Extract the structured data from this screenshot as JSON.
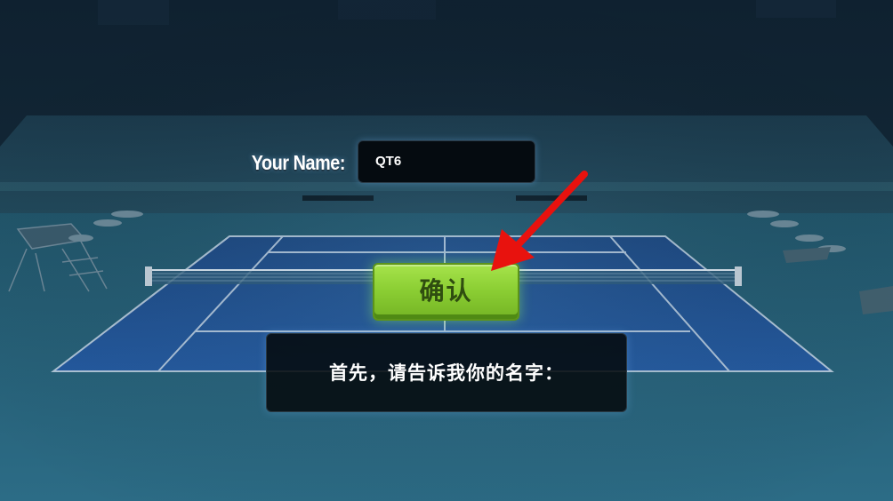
{
  "name_prompt": {
    "label": "Your Name:",
    "input_value": "QT6"
  },
  "confirm_button": {
    "label": "确认"
  },
  "instruction": {
    "text": "首先，请告诉我你的名字："
  },
  "colors": {
    "button_green": "#8ccf34",
    "arrow_red": "#e8120e",
    "court_blue": "#1c4d86"
  },
  "icons": {
    "pointer_arrow": "red-arrow-icon"
  }
}
